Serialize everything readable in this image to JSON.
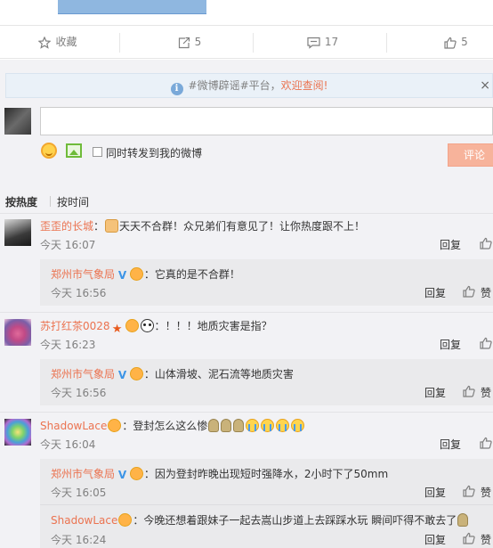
{
  "toolbar": {
    "favorite_label": "收藏",
    "repost_count": "5",
    "comment_count": "17",
    "like_count": "5"
  },
  "notice": {
    "info_glyph": "i",
    "text": "#微博辟谣#平台，",
    "link": "欢迎查阅!",
    "close": "×"
  },
  "composer": {
    "repost_label": "同时转发到我的微博",
    "submit_label": "评论"
  },
  "sort": {
    "hot": "按热度",
    "time": "按时间"
  },
  "actions": {
    "reply": "回复",
    "like": "赞"
  },
  "comments": [
    {
      "user": "歪歪的长城",
      "colon": "：",
      "text": "天天不合群！众兄弟们有意见了！让你热度跟不上！",
      "time": "今天 16:07",
      "reply": {
        "user": "郑州市气象局",
        "text": "：它真的是不合群！",
        "time": "今天 16:56"
      }
    },
    {
      "user": "苏打红茶0028",
      "colon": "：",
      "text": "！！！地质灾害是指？",
      "time": "今天 16:23",
      "reply": {
        "user": "郑州市气象局",
        "text": "：山体滑坡、泥石流等地质灾害",
        "time": "今天 16:56"
      }
    },
    {
      "user": "ShadowLace",
      "colon": "：",
      "text": "登封怎么这么惨",
      "time": "今天 16:04",
      "reply": {
        "user": "郑州市气象局",
        "text": "：因为登封昨晚出现短时强降水，2小时下了50mm",
        "time": "今天 16:05"
      },
      "reply2": {
        "user": "ShadowLace",
        "text": "：今晚还想着跟妹子一起去嵩山步道上去踩踩水玩 瞬间吓得不敢去了",
        "time": "今天 16:24"
      }
    }
  ],
  "colors": {
    "accent": "#eb7350",
    "link_blue": "#3c94e6",
    "muted": "#808080",
    "panel_bg": "#f2f2f5",
    "notice_bg": "#eaf1f8",
    "submit_bg": "#f7b39b"
  }
}
